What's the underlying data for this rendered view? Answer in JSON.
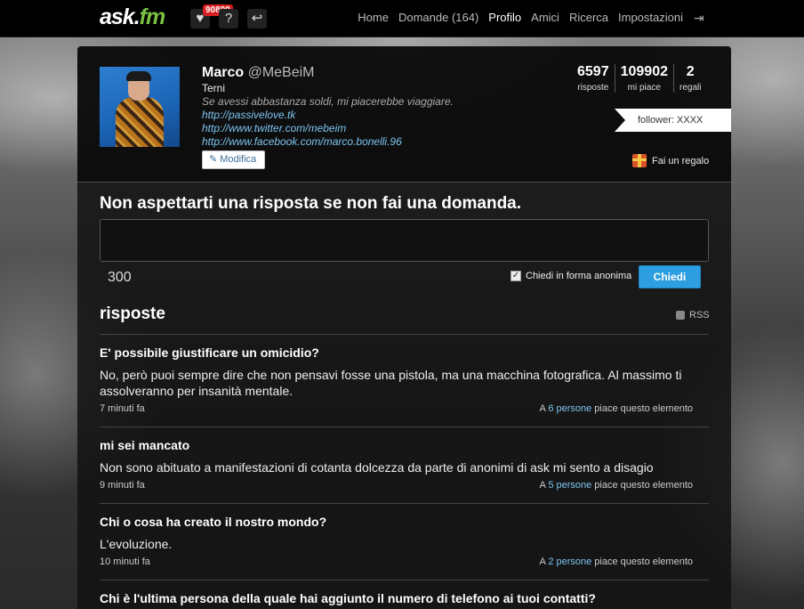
{
  "topbar": {
    "logo_main": "ask.",
    "logo_fm": "fm",
    "badge": "90809",
    "question_icon": "?",
    "nav": [
      {
        "label": "Home",
        "active": false
      },
      {
        "label": "Domande (164)",
        "active": false
      },
      {
        "label": "Profilo",
        "active": true
      },
      {
        "label": "Amici",
        "active": false
      },
      {
        "label": "Ricerca",
        "active": false
      },
      {
        "label": "Impostazioni",
        "active": false
      }
    ]
  },
  "profile": {
    "name": "Marco",
    "handle": "@MeBeiM",
    "city": "Terni",
    "bio": "Se avessi abbastanza soldi, mi piacerebbe viaggiare.",
    "links": [
      "http://passivelove.tk",
      "http://www.twitter.com/mebeim",
      "http://www.facebook.com/marco.bonelli.96"
    ],
    "edit_label": "Modifica",
    "stats": [
      {
        "num": "6597",
        "label": "risposte"
      },
      {
        "num": "109902",
        "label": "mi piace"
      },
      {
        "num": "2",
        "label": "regali"
      }
    ],
    "follower": "follower: XXXX",
    "gift_label": "Fai un regalo"
  },
  "ask": {
    "title": "Non aspettarti una risposta se non fai una domanda.",
    "counter": "300",
    "anon_label": "Chiedi in forma anonima",
    "anon_checked": true,
    "button": "Chiedi"
  },
  "answers": {
    "title": "risposte",
    "rss": "RSS",
    "items": [
      {
        "question": "E' possibile giustificare un omicidio?",
        "answer": "No, però puoi sempre dire che non pensavi fosse una pistola, ma una macchina fotografica. Al massimo ti assolveranno per insanità mentale.",
        "time": "7 minuti fa",
        "likes_pre": "A ",
        "likes_num": "6 persone",
        "likes_post": " piace questo elemento"
      },
      {
        "question": "mi sei mancato",
        "answer": "Non sono abituato a manifestazioni di cotanta dolcezza da parte di anonimi di ask mi sento a disagio",
        "time": "9 minuti fa",
        "likes_pre": "A ",
        "likes_num": "5 persone",
        "likes_post": " piace questo elemento"
      },
      {
        "question": "Chi o cosa ha creato il nostro mondo?",
        "answer": "L'evoluzione.",
        "time": "10 minuti fa",
        "likes_pre": "A ",
        "likes_num": "2 persone",
        "likes_post": " piace questo elemento"
      },
      {
        "question": "Chi è l'ultima persona della quale hai aggiunto il numero di telefono ai tuoi contatti?"
      }
    ]
  }
}
